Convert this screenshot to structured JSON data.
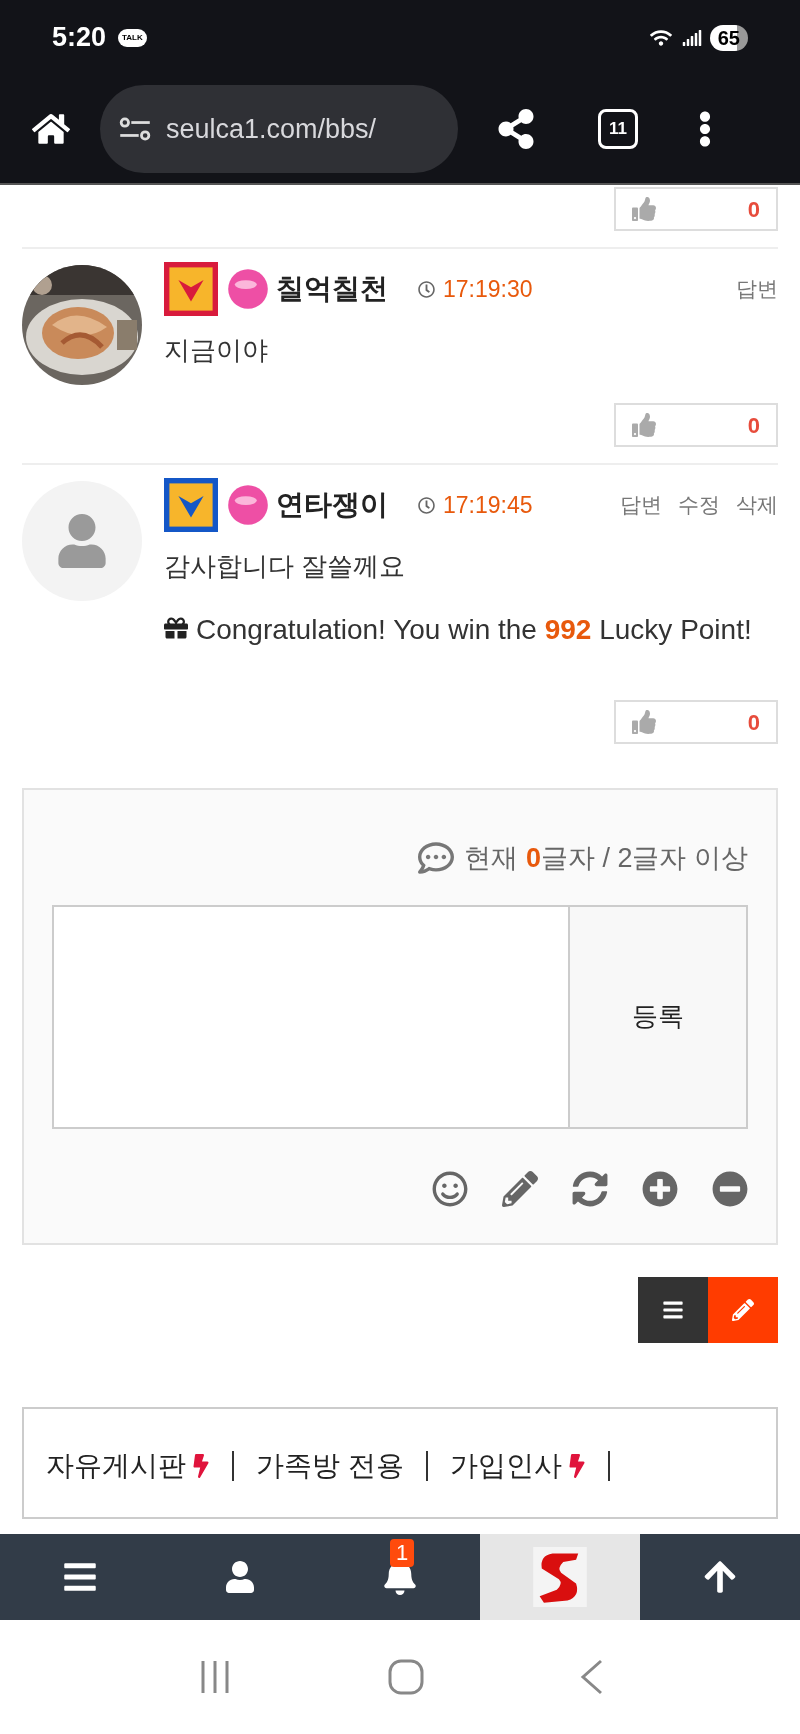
{
  "status_bar": {
    "time": "5:20",
    "notification": "TALK",
    "battery": "65"
  },
  "browser": {
    "url": "seulca1.com/bbs/",
    "tab_count": "11"
  },
  "top_like": {
    "count": "0"
  },
  "comments": [
    {
      "avatar": {
        "kind": "picture"
      },
      "badge": {
        "color": "#d81b3c"
      },
      "author": "칠억칠천",
      "time": "17:19:30",
      "actions": [
        "답변"
      ],
      "body": [
        {
          "kind": "text",
          "text": "지금이야"
        }
      ],
      "likes": "0"
    },
    {
      "avatar": {
        "kind": "default"
      },
      "badge": {
        "color": "#1457c7"
      },
      "author": "연타쟁이",
      "time": "17:19:45",
      "actions": [
        "답변",
        "수정",
        "삭제"
      ],
      "body": [
        {
          "kind": "text",
          "text": "감사합니다 잘쓸께요"
        },
        {
          "kind": "gift",
          "text": "Congratulation! You win the **992** Lucky Point!"
        }
      ],
      "likes": "0"
    }
  ],
  "comment_form": {
    "counter": "현재 **0**글자 / 2글자 이상",
    "submit": "등록",
    "tools": [
      {
        "kind": "smile"
      },
      {
        "kind": "pencil"
      },
      {
        "kind": "refresh"
      },
      {
        "kind": "plus"
      },
      {
        "kind": "minus"
      }
    ]
  },
  "board_buttons": [
    {
      "kind": "list"
    },
    {
      "kind": "write"
    }
  ],
  "board_links": [
    {
      "label": "자유게시판",
      "hot": true
    },
    {
      "label": "가족방 전용",
      "hot": false
    },
    {
      "label": "가입인사",
      "hot": true
    }
  ],
  "bottom_nav": [
    {
      "kind": "menu",
      "selected": false
    },
    {
      "kind": "user",
      "selected": false
    },
    {
      "kind": "bell",
      "selected": false,
      "badge": "1"
    },
    {
      "kind": "logo",
      "selected": true
    },
    {
      "kind": "top",
      "selected": false
    }
  ]
}
